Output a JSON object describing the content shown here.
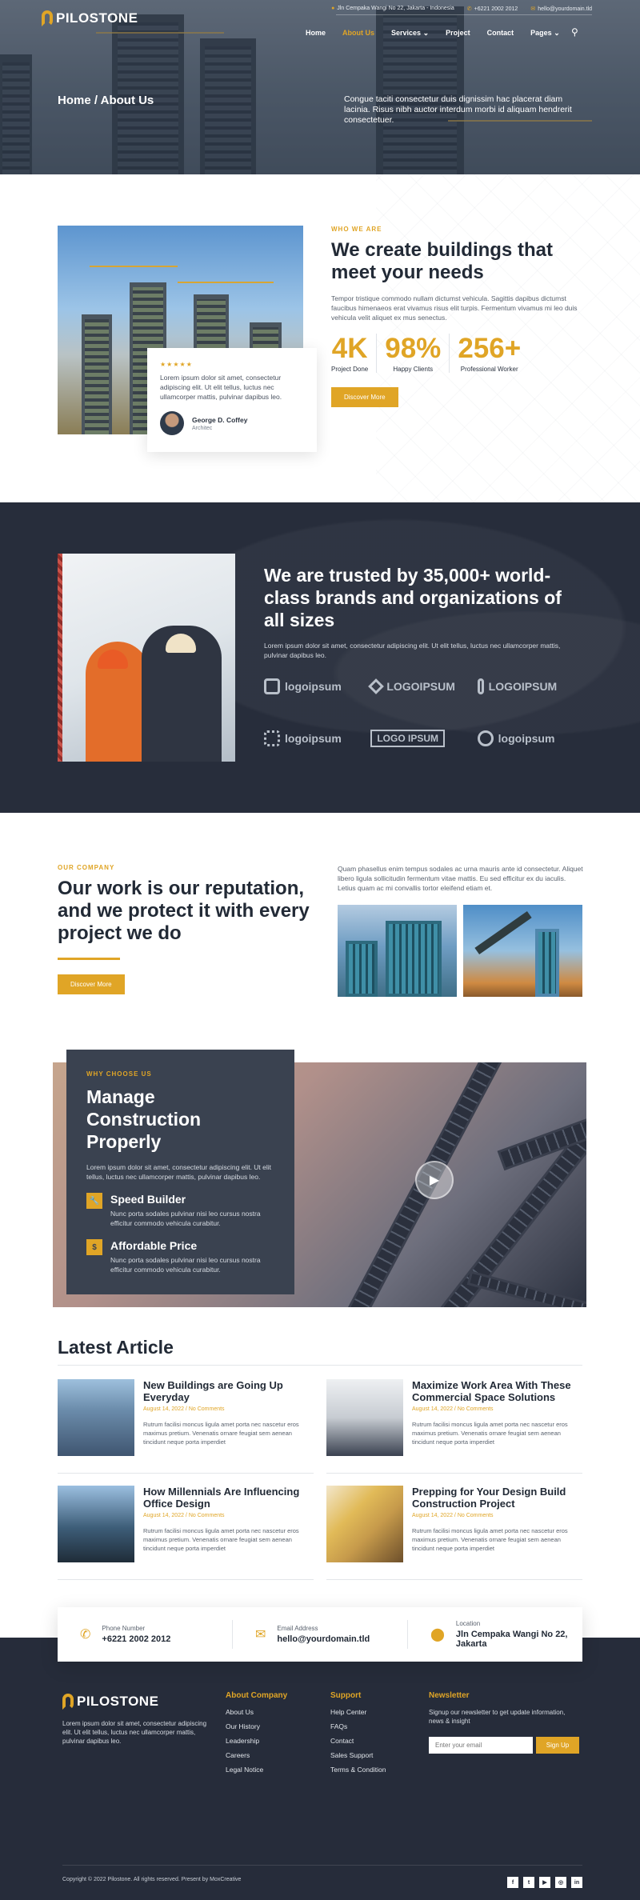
{
  "brand": {
    "name": "PILOSTONE"
  },
  "topbar": {
    "address": "Jln Cempaka Wangi No 22, Jakarta - Indonesia",
    "phone": "+6221 2002 2012",
    "email": "hello@yourdomain.tld"
  },
  "nav": {
    "items": [
      "Home",
      "About Us",
      "Services",
      "Project",
      "Contact",
      "Pages"
    ],
    "active": "About Us"
  },
  "hero": {
    "breadcrumb": "Home / About Us",
    "description": "Congue taciti consectetur duis dignissim hac placerat diam lacinia. Risus nibh auctor interdum morbi id aliquam hendrerit consectetuer."
  },
  "about": {
    "kicker": "WHO WE ARE",
    "title": "We create buildings that meet your needs",
    "description": "Tempor tristique commodo nullam dictumst vehicula. Sagittis dapibus dictumst faucibus himenaeos erat vivamus risus elit turpis. Fermentum vivamus mi leo duis vehicula velit aliquet ex mus senectus.",
    "stats": [
      {
        "value": "4K",
        "label": "Project Done"
      },
      {
        "value": "98%",
        "label": "Happy Clients"
      },
      {
        "value": "256+",
        "label": "Professional Worker"
      }
    ],
    "button": "Discover More",
    "testimonial": {
      "stars": "★★★★★",
      "text": "Lorem ipsum dolor sit amet, consectetur adipiscing elit. Ut elit tellus, luctus nec ullamcorper mattis, pulvinar dapibus leo.",
      "name": "George D. Coffey",
      "role": "Architec"
    }
  },
  "trusted": {
    "title": "We are trusted by 35,000+ world-class brands and organizations of all sizes",
    "description": "Lorem ipsum dolor sit amet, consectetur adipiscing elit. Ut elit tellus, luctus nec ullamcorper mattis, pulvinar dapibus leo.",
    "logos": [
      "logoipsum",
      "LOGOIPSUM",
      "LOGOIPSUM",
      "logoipsum",
      "LOGO IPSUM",
      "logoipsum"
    ]
  },
  "company": {
    "kicker": "OUR COMPANY",
    "title": "Our work is our reputation, and we protect it with every project we do",
    "button": "Discover More",
    "description": "Quam phasellus enim tempus sodales ac urna mauris ante id consectetur. Aliquet libero ligula sollicitudin fermentum vitae mattis. Eu sed efficitur ex du iaculis. Letius quam ac mi convallis tortor eleifend etiam et."
  },
  "why": {
    "kicker": "WHY CHOOSE US",
    "title": "Manage Construction Properly",
    "description": "Lorem ipsum dolor sit amet, consectetur adipiscing elit. Ut elit tellus, luctus nec ullamcorper mattis, pulvinar dapibus leo.",
    "features": [
      {
        "title": "Speed Builder",
        "text": "Nunc porta sodales pulvinar nisi leo cursus nostra efficitur commodo vehicula curabitur."
      },
      {
        "title": "Affordable Price",
        "text": "Nunc porta sodales pulvinar nisi leo cursus nostra efficitur commodo vehicula curabitur."
      }
    ]
  },
  "articles": {
    "title": "Latest Article",
    "items": [
      {
        "title": "New Buildings are Going Up Everyday",
        "meta": "August 14, 2022 / No Comments",
        "text": "Rutrum facilisi moncus ligula amet porta nec nascetur eros maximus pretium. Venenatis ornare feugiat sem aenean tincidunt neque porta imperdiet"
      },
      {
        "title": "Maximize Work Area With These Commercial Space Solutions",
        "meta": "August 14, 2022 / No Comments",
        "text": "Rutrum facilisi moncus ligula amet porta nec nascetur eros maximus pretium. Venenatis ornare feugiat sem aenean tincidunt neque porta imperdiet"
      },
      {
        "title": "How Millennials Are Influencing Office Design",
        "meta": "August 14, 2022 / No Comments",
        "text": "Rutrum facilisi moncus ligula amet porta nec nascetur eros maximus pretium. Venenatis ornare feugiat sem aenean tincidunt neque porta imperdiet"
      },
      {
        "title": "Prepping for Your Design Build Construction Project",
        "meta": "August 14, 2022 / No Comments",
        "text": "Rutrum facilisi moncus ligula amet porta nec nascetur eros maximus pretium. Venenatis ornare feugiat sem aenean tincidunt neque porta imperdiet"
      }
    ]
  },
  "contact": {
    "phone_label": "Phone Number",
    "phone": "+6221 2002 2012",
    "email_label": "Email Address",
    "email": "hello@yourdomain.tld",
    "location_label": "Location",
    "location": "Jln Cempaka Wangi No 22, Jakarta"
  },
  "footer": {
    "description": "Lorem ipsum dolor sit amet, consectetur adipiscing elit. Ut elit tellus, luctus nec ullamcorper mattis, pulvinar dapibus leo.",
    "about_title": "About Company",
    "about_links": [
      "About Us",
      "Our History",
      "Leadership",
      "Careers",
      "Legal Notice"
    ],
    "support_title": "Support",
    "support_links": [
      "Help Center",
      "FAQs",
      "Contact",
      "Sales Support",
      "Terms & Condition"
    ],
    "newsletter_title": "Newsletter",
    "newsletter_desc": "Signup our newsletter to get update information, news & insight",
    "newsletter_placeholder": "Enter your email",
    "newsletter_button": "Sign Up",
    "copyright": "Copyright © 2022 Pilostone. All rights reserved. Present by MoxCreative",
    "social": [
      "f",
      "t",
      "▶",
      "◎",
      "in"
    ]
  },
  "colors": {
    "accent": "#e0a526",
    "dark": "#272d3b",
    "card": "#3a4250"
  }
}
